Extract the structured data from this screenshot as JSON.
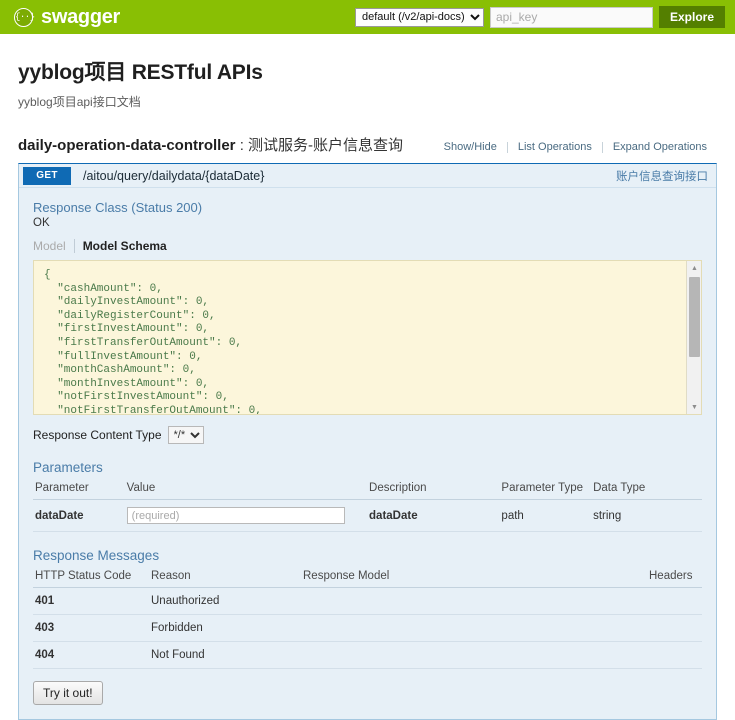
{
  "topbar": {
    "logo_text": "swagger",
    "logo_icon": "swagger-braces-icon",
    "api_select_value": "default (/v2/api-docs)",
    "api_key_placeholder": "api_key",
    "api_key_value": "",
    "explore_label": "Explore",
    "background_color": "#89bf04",
    "explore_color": "#547f00"
  },
  "page": {
    "title": "yyblog项目 RESTful APIs",
    "subtitle": "yyblog项目api接口文档"
  },
  "resource": {
    "name": "daily-operation-data-controller",
    "separator": " : ",
    "description": "测试服务-账户信息查询",
    "links": [
      {
        "label": "Show/Hide"
      },
      {
        "label": "List Operations"
      },
      {
        "label": "Expand Operations"
      }
    ]
  },
  "operation": {
    "method": "GET",
    "method_color": "#0f6ab4",
    "path": "/aitou/query/dailydata/{dataDate}",
    "summary": "账户信息查询接口",
    "response_class_title": "Response Class (Status 200)",
    "response_class_status": "OK",
    "model_tabs": [
      {
        "label": "Model",
        "active": false
      },
      {
        "label": "Model Schema",
        "active": true
      }
    ],
    "model_schema_json": "{\n  \"cashAmount\": 0,\n  \"dailyInvestAmount\": 0,\n  \"dailyRegisterCount\": 0,\n  \"firstInvestAmount\": 0,\n  \"firstTransferOutAmount\": 0,\n  \"fullInvestAmount\": 0,\n  \"monthCashAmount\": 0,\n  \"monthInvestAmount\": 0,\n  \"notFirstInvestAmount\": 0,\n  \"notFirstTransferOutAmount\": 0,",
    "content_type_label": "Response Content Type",
    "content_type_value": "*/*"
  },
  "parameters": {
    "title": "Parameters",
    "columns": [
      "Parameter",
      "Value",
      "Description",
      "Parameter Type",
      "Data Type"
    ],
    "rows": [
      {
        "name": "dataDate",
        "value": "",
        "value_placeholder": "(required)",
        "description": "dataDate",
        "parameter_type": "path",
        "data_type": "string"
      }
    ]
  },
  "response_messages": {
    "title": "Response Messages",
    "columns": [
      "HTTP Status Code",
      "Reason",
      "Response Model",
      "Headers"
    ],
    "rows": [
      {
        "code": "401",
        "reason": "Unauthorized",
        "model": "",
        "headers": ""
      },
      {
        "code": "403",
        "reason": "Forbidden",
        "model": "",
        "headers": ""
      },
      {
        "code": "404",
        "reason": "Not Found",
        "model": "",
        "headers": ""
      }
    ]
  },
  "actions": {
    "try_it_out_label": "Try it out!"
  }
}
